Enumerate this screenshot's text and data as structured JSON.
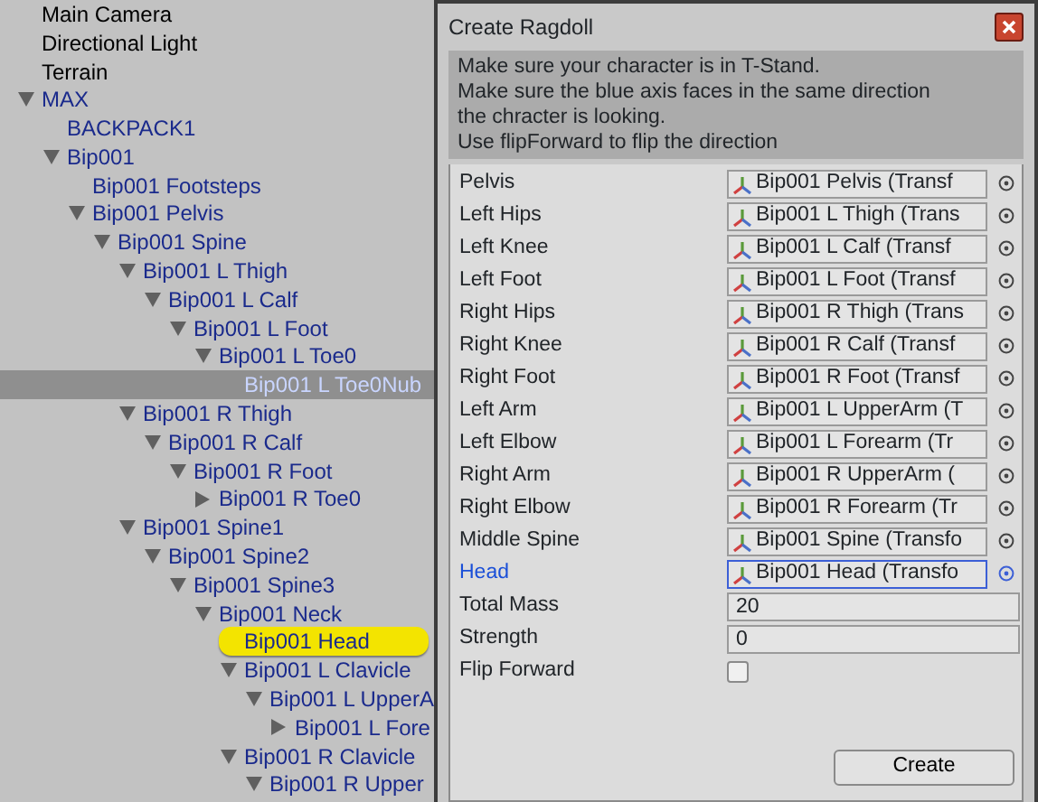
{
  "hierarchy": {
    "items": [
      {
        "label": "Main Camera",
        "kind": "leaf",
        "prefab": false,
        "selected": false,
        "highlighted": false
      },
      {
        "label": "Directional Light",
        "kind": "leaf",
        "prefab": false,
        "selected": false,
        "highlighted": false
      },
      {
        "label": "Terrain",
        "kind": "leaf",
        "prefab": false,
        "selected": false,
        "highlighted": false
      },
      {
        "label": "MAX",
        "kind": "branch",
        "expanded": true,
        "prefab": true,
        "selected": false,
        "highlighted": false,
        "children": [
          {
            "label": "BACKPACK1",
            "kind": "leaf",
            "prefab": true,
            "selected": false,
            "highlighted": false
          },
          {
            "label": "Bip001",
            "kind": "branch",
            "expanded": true,
            "prefab": true,
            "selected": false,
            "highlighted": false,
            "children": [
              {
                "label": "Bip001 Footsteps",
                "kind": "leaf",
                "prefab": true,
                "selected": false,
                "highlighted": false
              },
              {
                "label": "Bip001 Pelvis",
                "kind": "branch",
                "expanded": true,
                "prefab": true,
                "selected": false,
                "highlighted": false,
                "children": [
                  {
                    "label": "Bip001 Spine",
                    "kind": "branch",
                    "expanded": true,
                    "prefab": true,
                    "selected": false,
                    "highlighted": false,
                    "children": [
                      {
                        "label": "Bip001 L Thigh",
                        "kind": "branch",
                        "expanded": true,
                        "prefab": true,
                        "selected": false,
                        "highlighted": false,
                        "children": [
                          {
                            "label": "Bip001 L Calf",
                            "kind": "branch",
                            "expanded": true,
                            "prefab": true,
                            "selected": false,
                            "highlighted": false,
                            "children": [
                              {
                                "label": "Bip001 L Foot",
                                "kind": "branch",
                                "expanded": true,
                                "prefab": true,
                                "selected": false,
                                "highlighted": false,
                                "children": [
                                  {
                                    "label": "Bip001 L Toe0",
                                    "kind": "branch",
                                    "expanded": true,
                                    "prefab": true,
                                    "selected": false,
                                    "highlighted": false,
                                    "children": [
                                      {
                                        "label": "Bip001 L Toe0Nub",
                                        "kind": "leaf",
                                        "prefab": true,
                                        "selected": true,
                                        "highlighted": false
                                      }
                                    ]
                                  }
                                ]
                              }
                            ]
                          }
                        ]
                      },
                      {
                        "label": "Bip001 R Thigh",
                        "kind": "branch",
                        "expanded": true,
                        "prefab": true,
                        "selected": false,
                        "highlighted": false,
                        "children": [
                          {
                            "label": "Bip001 R Calf",
                            "kind": "branch",
                            "expanded": true,
                            "prefab": true,
                            "selected": false,
                            "highlighted": false,
                            "children": [
                              {
                                "label": "Bip001 R Foot",
                                "kind": "branch",
                                "expanded": true,
                                "prefab": true,
                                "selected": false,
                                "highlighted": false,
                                "children": [
                                  {
                                    "label": "Bip001 R Toe0",
                                    "kind": "branch",
                                    "expanded": false,
                                    "prefab": true,
                                    "selected": false,
                                    "highlighted": false
                                  }
                                ]
                              }
                            ]
                          }
                        ]
                      },
                      {
                        "label": "Bip001 Spine1",
                        "kind": "branch",
                        "expanded": true,
                        "prefab": true,
                        "selected": false,
                        "highlighted": false,
                        "children": [
                          {
                            "label": "Bip001 Spine2",
                            "kind": "branch",
                            "expanded": true,
                            "prefab": true,
                            "selected": false,
                            "highlighted": false,
                            "children": [
                              {
                                "label": "Bip001 Spine3",
                                "kind": "branch",
                                "expanded": true,
                                "prefab": true,
                                "selected": false,
                                "highlighted": false,
                                "children": [
                                  {
                                    "label": "Bip001 Neck",
                                    "kind": "branch",
                                    "expanded": true,
                                    "prefab": true,
                                    "selected": false,
                                    "highlighted": false,
                                    "children": [
                                      {
                                        "label": "Bip001 Head",
                                        "kind": "leaf",
                                        "prefab": true,
                                        "selected": false,
                                        "highlighted": true
                                      },
                                      {
                                        "label": "Bip001 L Clavicle",
                                        "kind": "branch",
                                        "expanded": true,
                                        "prefab": true,
                                        "selected": false,
                                        "highlighted": false,
                                        "children": [
                                          {
                                            "label": "Bip001 L UpperA",
                                            "kind": "branch",
                                            "expanded": true,
                                            "prefab": true,
                                            "selected": false,
                                            "highlighted": false,
                                            "children": [
                                              {
                                                "label": "Bip001 L Fore",
                                                "kind": "branch",
                                                "expanded": false,
                                                "prefab": true,
                                                "selected": false,
                                                "highlighted": false
                                              }
                                            ]
                                          }
                                        ]
                                      },
                                      {
                                        "label": "Bip001 R Clavicle",
                                        "kind": "branch",
                                        "expanded": true,
                                        "prefab": true,
                                        "selected": false,
                                        "highlighted": false,
                                        "children": [
                                          {
                                            "label": "Bip001 R Upper",
                                            "kind": "branch",
                                            "expanded": true,
                                            "prefab": true,
                                            "selected": false,
                                            "highlighted": false
                                          }
                                        ]
                                      }
                                    ]
                                  }
                                ]
                              }
                            ]
                          }
                        ]
                      }
                    ]
                  }
                ]
              }
            ]
          }
        ]
      }
    ]
  },
  "dialog": {
    "title": "Create Ragdoll",
    "help_lines": [
      "Make sure your character is in T-Stand.",
      "Make sure the blue axis faces in the same direction",
      "the chracter is looking.",
      "Use flipForward to flip the direction"
    ],
    "fields": [
      {
        "kind": "object",
        "label": "Pelvis",
        "value": "Bip001 Pelvis (Transf",
        "selected": false
      },
      {
        "kind": "object",
        "label": "Left Hips",
        "value": "Bip001 L Thigh (Trans",
        "selected": false
      },
      {
        "kind": "object",
        "label": "Left Knee",
        "value": "Bip001 L Calf (Transf",
        "selected": false
      },
      {
        "kind": "object",
        "label": "Left Foot",
        "value": "Bip001 L Foot (Transf",
        "selected": false
      },
      {
        "kind": "object",
        "label": "Right Hips",
        "value": "Bip001 R Thigh (Trans",
        "selected": false
      },
      {
        "kind": "object",
        "label": "Right Knee",
        "value": "Bip001 R Calf (Transf",
        "selected": false
      },
      {
        "kind": "object",
        "label": "Right Foot",
        "value": "Bip001 R Foot (Transf",
        "selected": false
      },
      {
        "kind": "object",
        "label": "Left Arm",
        "value": "Bip001 L UpperArm (T",
        "selected": false
      },
      {
        "kind": "object",
        "label": "Left Elbow",
        "value": "Bip001 L Forearm (Tr",
        "selected": false
      },
      {
        "kind": "object",
        "label": "Right Arm",
        "value": "Bip001 R UpperArm (",
        "selected": false
      },
      {
        "kind": "object",
        "label": "Right Elbow",
        "value": "Bip001 R Forearm (Tr",
        "selected": false
      },
      {
        "kind": "object",
        "label": "Middle Spine",
        "value": "Bip001 Spine (Transfo",
        "selected": false
      },
      {
        "kind": "object",
        "label": "Head",
        "value": "Bip001 Head (Transfo",
        "selected": true
      },
      {
        "kind": "number",
        "label": "Total Mass",
        "value": "20",
        "selected": false
      },
      {
        "kind": "number",
        "label": "Strength",
        "value": "0",
        "selected": false
      },
      {
        "kind": "checkbox",
        "label": "Flip Forward",
        "checked": false,
        "selected": false
      }
    ],
    "buttons": [
      "Create"
    ]
  }
}
